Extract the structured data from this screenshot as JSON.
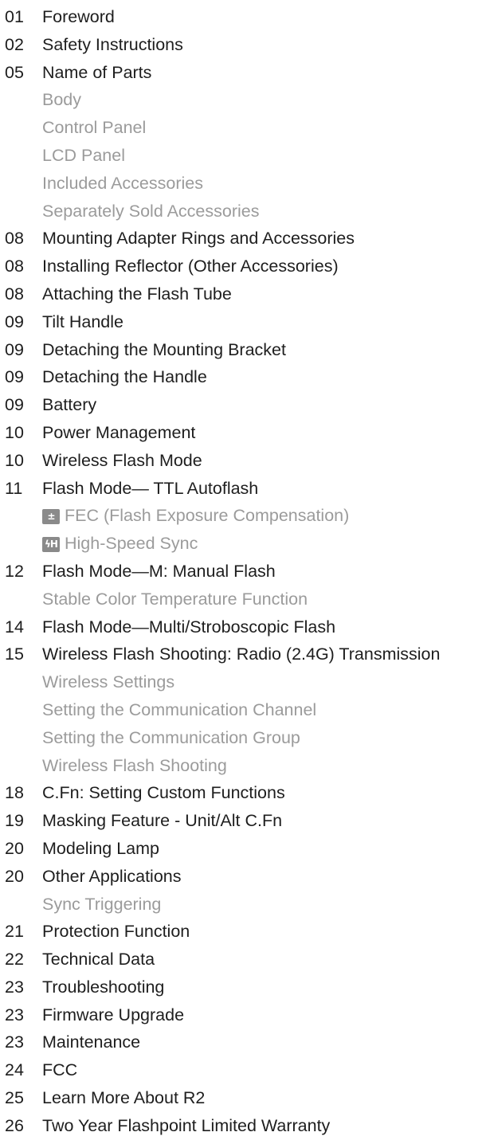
{
  "toc": {
    "entries": [
      {
        "page": "01",
        "title": "Foreword",
        "level": 0
      },
      {
        "page": "02",
        "title": "Safety Instructions",
        "level": 0
      },
      {
        "page": "05",
        "title": "Name of Parts",
        "level": 0
      },
      {
        "page": "",
        "title": "Body",
        "level": 1
      },
      {
        "page": "",
        "title": "Control Panel",
        "level": 1
      },
      {
        "page": "",
        "title": "LCD Panel",
        "level": 1
      },
      {
        "page": "",
        "title": "Included Accessories",
        "level": 1
      },
      {
        "page": "",
        "title": "Separately Sold Accessories",
        "level": 1
      },
      {
        "page": "08",
        "title": "Mounting Adapter Rings and Accessories",
        "level": 0
      },
      {
        "page": "08",
        "title": "Installing Reflector (Other Accessories)",
        "level": 0
      },
      {
        "page": "08",
        "title": "Attaching the Flash Tube",
        "level": 0
      },
      {
        "page": "09",
        "title": "Tilt Handle",
        "level": 0
      },
      {
        "page": "09",
        "title": "Detaching the Mounting Bracket",
        "level": 0
      },
      {
        "page": "09",
        "title": "Detaching the Handle",
        "level": 0
      },
      {
        "page": "09",
        "title": "Battery",
        "level": 0
      },
      {
        "page": "10",
        "title": "Power Management",
        "level": 0
      },
      {
        "page": "10",
        "title": "Wireless Flash Mode",
        "level": 0
      },
      {
        "page": "11",
        "title": "Flash Mode— TTL Autoflash",
        "level": 0
      },
      {
        "page": "",
        "title": "FEC (Flash Exposure Compensation)",
        "level": 1,
        "icon": "fec-icon",
        "icon_glyph": "±"
      },
      {
        "page": "",
        "title": "High-Speed Sync",
        "level": 1,
        "icon": "high-speed-sync-icon",
        "icon_glyph": "ϟH"
      },
      {
        "page": "12",
        "title": "Flash Mode—M: Manual Flash",
        "level": 0
      },
      {
        "page": "",
        "title": "Stable Color Temperature Function",
        "level": 1
      },
      {
        "page": "14",
        "title": "Flash Mode—Multi/Stroboscopic Flash",
        "level": 0
      },
      {
        "page": "15",
        "title": "Wireless Flash Shooting: Radio (2.4G) Transmission",
        "level": 0
      },
      {
        "page": "",
        "title": "Wireless Settings",
        "level": 1
      },
      {
        "page": "",
        "title": "Setting the Communication Channel",
        "level": 1
      },
      {
        "page": "",
        "title": "Setting the Communication Group",
        "level": 1
      },
      {
        "page": "",
        "title": "Wireless Flash Shooting",
        "level": 1
      },
      {
        "page": "18",
        "title": "C.Fn: Setting Custom Functions",
        "level": 0
      },
      {
        "page": "19",
        "title": "Masking Feature - Unit/Alt C.Fn",
        "level": 0
      },
      {
        "page": "20",
        "title": "Modeling Lamp",
        "level": 0
      },
      {
        "page": "20",
        "title": "Other Applications",
        "level": 0
      },
      {
        "page": "",
        "title": "Sync Triggering",
        "level": 1
      },
      {
        "page": "21",
        "title": "Protection Function",
        "level": 0
      },
      {
        "page": "22",
        "title": "Technical Data",
        "level": 0
      },
      {
        "page": "23",
        "title": "Troubleshooting",
        "level": 0
      },
      {
        "page": "23",
        "title": "Firmware Upgrade",
        "level": 0
      },
      {
        "page": "23",
        "title": "Maintenance",
        "level": 0
      },
      {
        "page": "24",
        "title": "FCC",
        "level": 0
      },
      {
        "page": "25",
        "title": "Learn More About R2",
        "level": 0
      },
      {
        "page": "26",
        "title": "Two Year Flashpoint Limited Warranty",
        "level": 0
      }
    ]
  },
  "colors": {
    "main_text": "#1e1e1e",
    "sub_text": "#9b9b9b",
    "icon_bg": "#8a8a8a"
  }
}
